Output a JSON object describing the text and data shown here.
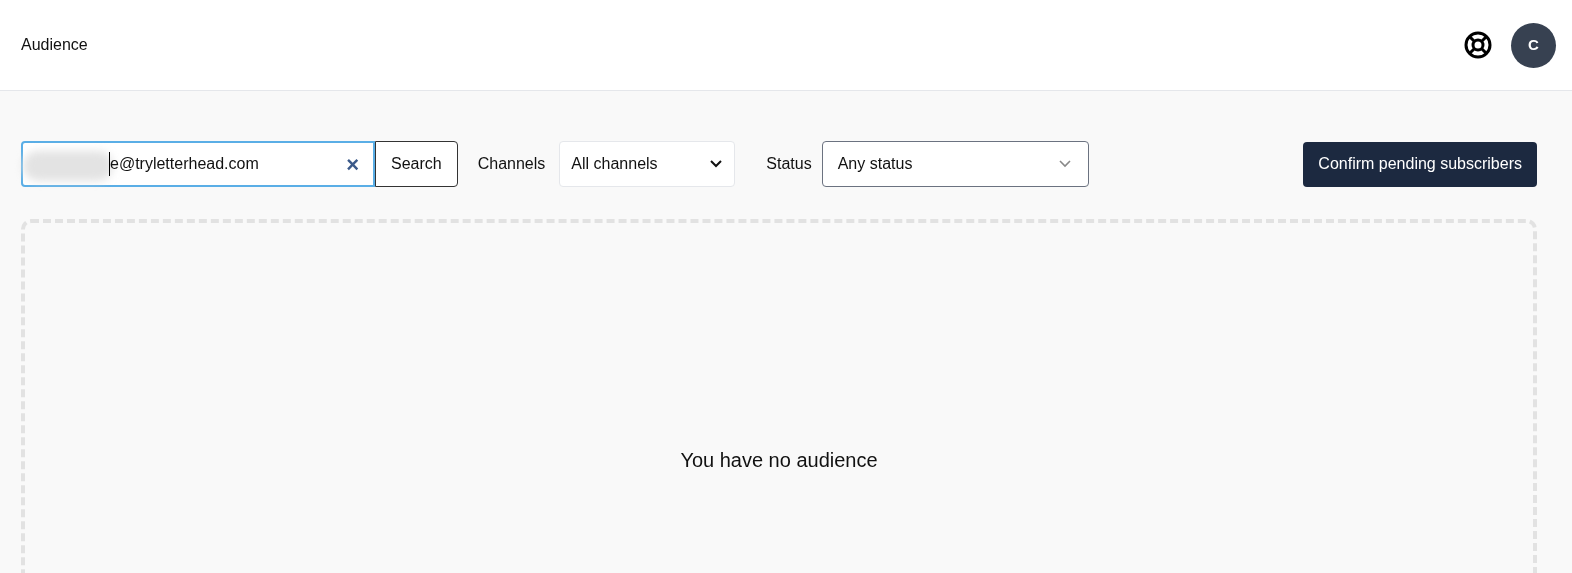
{
  "header": {
    "title": "Audience",
    "avatar": "C"
  },
  "toolbar": {
    "search": {
      "value": "e@tryletterhead.com",
      "clear": "×",
      "button": "Search"
    },
    "channels": {
      "label": "Channels",
      "value": "All channels"
    },
    "status": {
      "label": "Status",
      "value": "Any status"
    },
    "confirm_button": "Confirm pending subscribers"
  },
  "empty_state": {
    "message": "You have no audience"
  }
}
